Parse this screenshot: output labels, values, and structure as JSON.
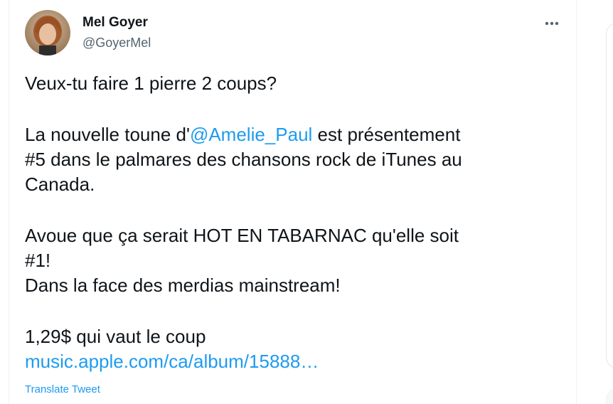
{
  "author": {
    "display_name": "Mel Goyer",
    "handle": "@GoyerMel"
  },
  "tweet": {
    "line_1": "Veux-tu faire 1 pierre 2 coups?",
    "line_2_prefix": "La nouvelle toune d'",
    "mention": "@Amelie_Paul",
    "line_2_suffix": " est présentement",
    "line_3": "#5 dans le palmares des chansons rock de iTunes au",
    "line_4": "Canada.",
    "line_5": "Avoue que ça serait HOT EN TABARNAC qu'elle soit",
    "line_6": "#1!",
    "line_7": "Dans la face des merdias mainstream!",
    "line_8": "1,29$ qui vaut le coup",
    "link_text": "music.apple.com/ca/album/15888…"
  },
  "actions": {
    "translate_label": "Translate Tweet",
    "more_icon": "more-horizontal-icon"
  },
  "colors": {
    "text": "#0f1419",
    "secondary": "#536471",
    "accent": "#1d9bf0"
  }
}
